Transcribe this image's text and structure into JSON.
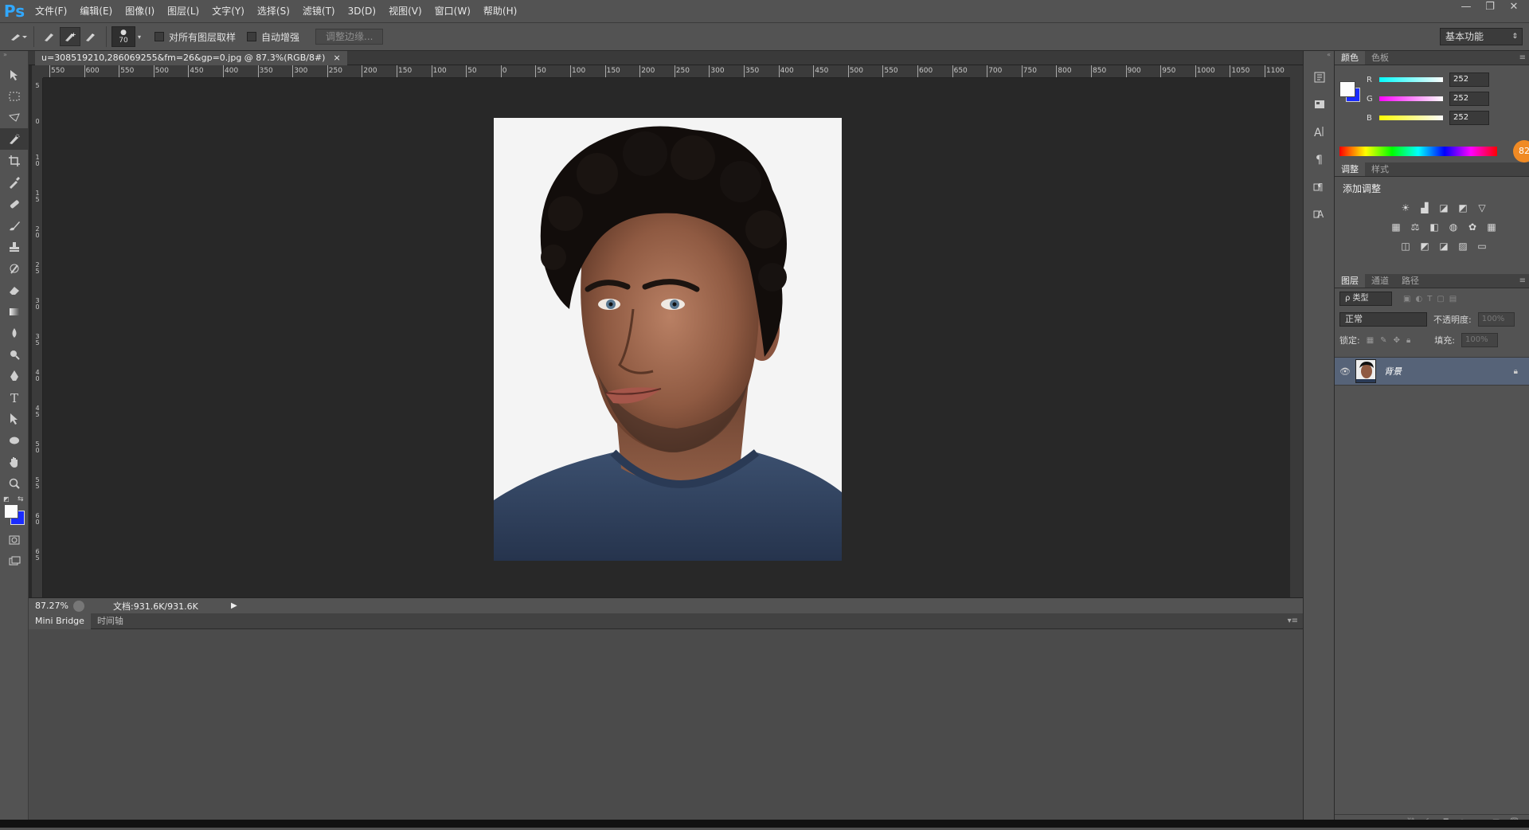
{
  "app": {
    "logo": "Ps"
  },
  "menu": [
    "文件(F)",
    "编辑(E)",
    "图像(I)",
    "图层(L)",
    "文字(Y)",
    "选择(S)",
    "滤镜(T)",
    "3D(D)",
    "视图(V)",
    "窗口(W)",
    "帮助(H)"
  ],
  "window_controls": [
    "—",
    "❐",
    "✕"
  ],
  "options": {
    "brush_size": "70",
    "sample_all_layers": "对所有图层取样",
    "auto_enhance": "自动增强",
    "refine_edge": "调整边缘...",
    "workspace": "基本功能"
  },
  "document": {
    "tab_title": "u=308519210,286069255&fm=26&gp=0.jpg @ 87.3%(RGB/8#)",
    "tab_close": "×",
    "ruler_labels": [
      "550",
      "600",
      "550",
      "500",
      "450",
      "400",
      "350",
      "300",
      "250",
      "200",
      "150",
      "100",
      "50",
      "0",
      "50",
      "100",
      "150",
      "200",
      "250",
      "300",
      "350",
      "400",
      "450",
      "500",
      "550",
      "600",
      "650",
      "700",
      "750",
      "800",
      "850",
      "900",
      "950",
      "1000",
      "1050",
      "1100"
    ],
    "vruler_labels": [
      "5",
      "0",
      "1 0",
      "1 5",
      "2 0",
      "2 5",
      "3 0",
      "3 5",
      "4 0",
      "4 5",
      "5 0",
      "5 5",
      "6 0",
      "6 5"
    ]
  },
  "status": {
    "zoom": "87.27%",
    "doc_size": "文档:931.6K/931.6K"
  },
  "bottom_panel": {
    "tabs": [
      "Mini Bridge",
      "时间轴"
    ]
  },
  "color_panel": {
    "tabs": [
      "颜色",
      "色板"
    ],
    "r_label": "R",
    "g_label": "G",
    "b_label": "B",
    "r": "252",
    "g": "252",
    "b": "252",
    "foreground": "#fcfcfc",
    "background": "#1a2cff"
  },
  "adjust_panel": {
    "tabs": [
      "调整",
      "样式"
    ],
    "title": "添加调整"
  },
  "layers_panel": {
    "tabs": [
      "图层",
      "通道",
      "路径"
    ],
    "filter": "ρ 类型",
    "blend_mode": "正常",
    "opacity_label": "不透明度:",
    "opacity_value": "100%",
    "lock_label": "锁定:",
    "fill_label": "填充:",
    "fill_value": "100%",
    "layers": [
      {
        "name": "背景"
      }
    ]
  },
  "badge": "82",
  "colors": {
    "accent": "#31a8ff",
    "selected_layer": "#566378",
    "badge": "#f08a24"
  }
}
